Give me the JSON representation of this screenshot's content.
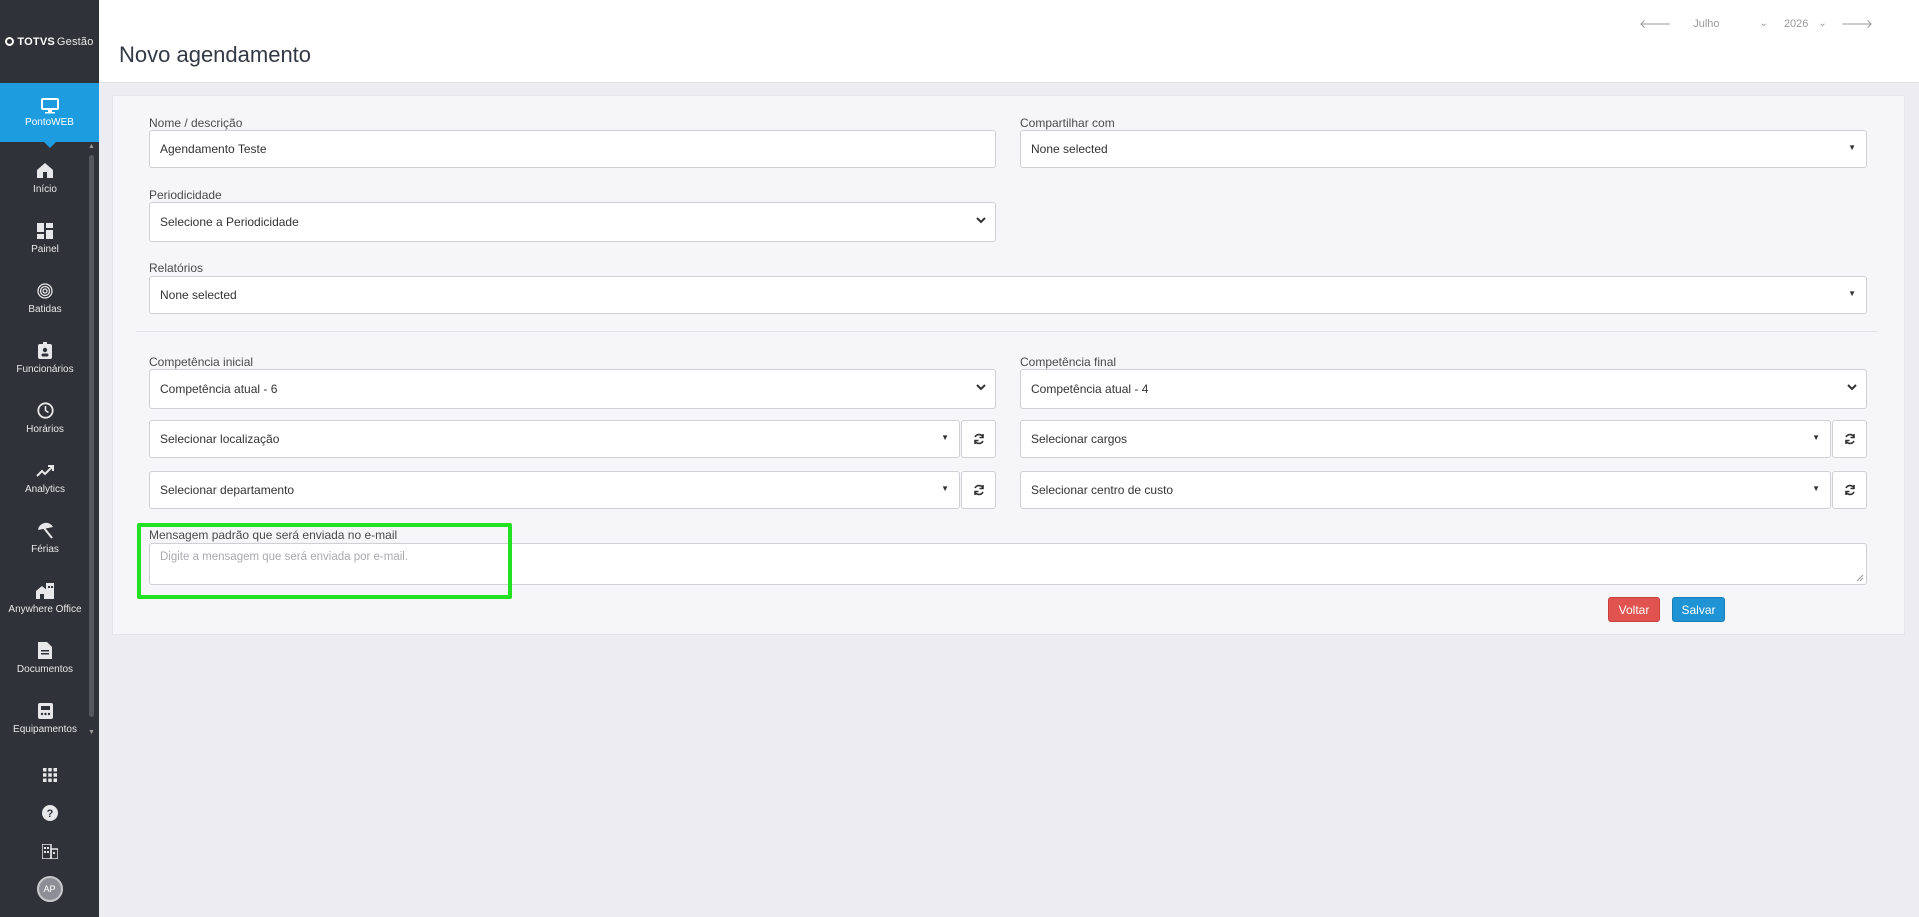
{
  "app": {
    "logo_brand": "TOTVS",
    "logo_sub": "Gestão"
  },
  "sidebar": {
    "module_label": "PontoWEB",
    "items": [
      {
        "label": "Início",
        "icon": "home-icon"
      },
      {
        "label": "Painel",
        "icon": "dashboard-icon"
      },
      {
        "label": "Batidas",
        "icon": "fingerprint-icon"
      },
      {
        "label": "Funcionários",
        "icon": "badge-icon"
      },
      {
        "label": "Horários",
        "icon": "clock-icon"
      },
      {
        "label": "Analytics",
        "icon": "trending-icon"
      },
      {
        "label": "Férias",
        "icon": "beach-umbrella-icon"
      },
      {
        "label": "Anywhere Office",
        "icon": "house-building-icon"
      },
      {
        "label": "Documentos",
        "icon": "document-icon"
      },
      {
        "label": "Equipamentos",
        "icon": "device-icon"
      }
    ],
    "bottom": {
      "apps_icon": "apps-grid-icon",
      "help_icon": "help-icon",
      "company_icon": "building-icon",
      "avatar_initials": "AP"
    }
  },
  "header": {
    "title": "Novo agendamento",
    "month": "Julho",
    "year": "2026"
  },
  "form": {
    "name_label": "Nome / descrição",
    "name_value": "Agendamento Teste",
    "share_label": "Compartilhar com",
    "share_value": "None selected",
    "periodicity_label": "Periodicidade",
    "periodicity_value": "Selecione a Periodicidade",
    "reports_label": "Relatórios",
    "reports_value": "None selected",
    "comp_initial_label": "Competência inicial",
    "comp_initial_value": "Competência atual - 6",
    "comp_final_label": "Competência final",
    "comp_final_value": "Competência atual - 4",
    "location_value": "Selecionar localização",
    "roles_value": "Selecionar cargos",
    "department_value": "Selecionar departamento",
    "cost_center_value": "Selecionar centro de custo",
    "message_label": "Mensagem padrão que será enviada no e-mail",
    "message_placeholder": "Digite a mensagem que será enviada por e-mail.",
    "back_label": "Voltar",
    "save_label": "Salvar"
  },
  "colors": {
    "sidebar_bg": "#2f3238",
    "module_active": "#1e9ce0",
    "back_button": "#e0534f",
    "save_button": "#1f93d3",
    "highlight": "#22e022"
  }
}
